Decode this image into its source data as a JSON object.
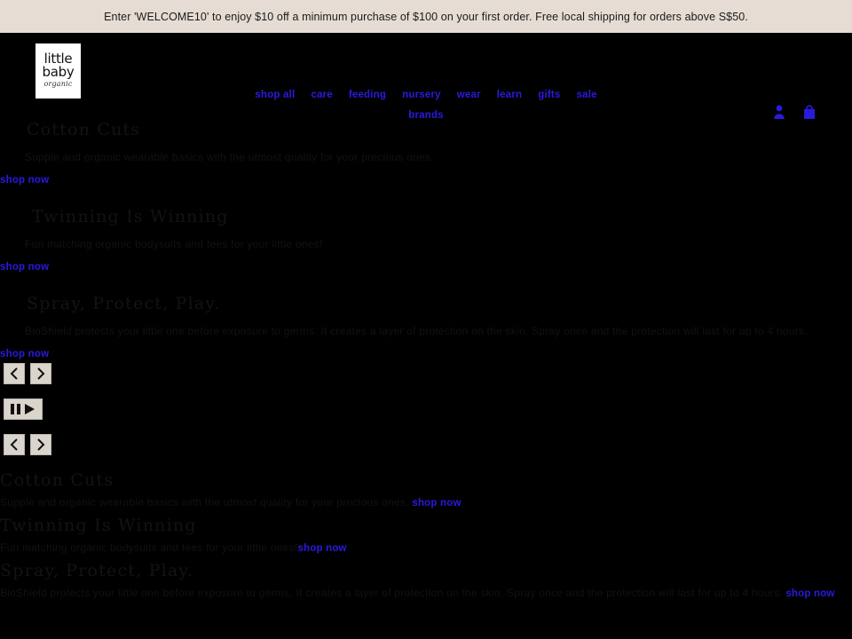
{
  "announcement": {
    "text": "Enter 'WELCOME10' to enjoy $10 off a minimum purchase of $100 on your first order. Free local shipping for orders above S$50."
  },
  "header": {
    "logo": {
      "line1": "little",
      "line2": "baby",
      "line3": "organic",
      "alt": "little baby organic"
    },
    "nav": [
      {
        "label": "shop all"
      },
      {
        "label": "care"
      },
      {
        "label": "feeding"
      },
      {
        "label": "nursery"
      },
      {
        "label": "wear"
      },
      {
        "label": "learn"
      },
      {
        "label": "gifts"
      },
      {
        "label": "sale"
      },
      {
        "label": "brands"
      }
    ],
    "actions": {
      "account": "account-icon",
      "cart": "cart-icon"
    }
  },
  "slideshow": {
    "slides": [
      {
        "title": "Cotton Cuts",
        "description": "Supple and organic wearable basics with the utmost quality for your precious ones.",
        "cta": "shop now"
      },
      {
        "title": "Twinning Is Winning",
        "description": "Fun matching organic bodysuits and tees for your little ones!",
        "cta": "shop now"
      },
      {
        "title": "Spray, Protect, Play.",
        "description": "BioShield protects your little one before exposure to germs. It creates a layer of protection on the skin. Spray once and the protection will last for up to 4 hours.",
        "cta": "shop now"
      }
    ],
    "controls": {
      "previous": "Previous slide",
      "next": "Next slide",
      "pause": "Pause slideshow",
      "play": "Play slideshow"
    }
  },
  "alt_content": {
    "blocks": [
      {
        "title": "Cotton Cuts",
        "description": "Supple and organic wearable basics with the utmost quality for your precious ones.",
        "cta": "shop now"
      },
      {
        "title": "Twinning Is Winning",
        "description": "Fun matching organic bodysuits and tees for your little ones!",
        "cta": "shop now"
      },
      {
        "title": "Spray, Protect, Play.",
        "description": "BioShield protects your little one before exposure to germs. It creates a layer of protection on the skin. Spray once and the protection will last for up to 4 hours.",
        "cta": "shop now"
      }
    ]
  },
  "colors": {
    "announcement_bg": "#e6dcd3",
    "page_bg": "#000000",
    "link": "#2a1ae0",
    "control_bg": "#d9d5cd"
  }
}
